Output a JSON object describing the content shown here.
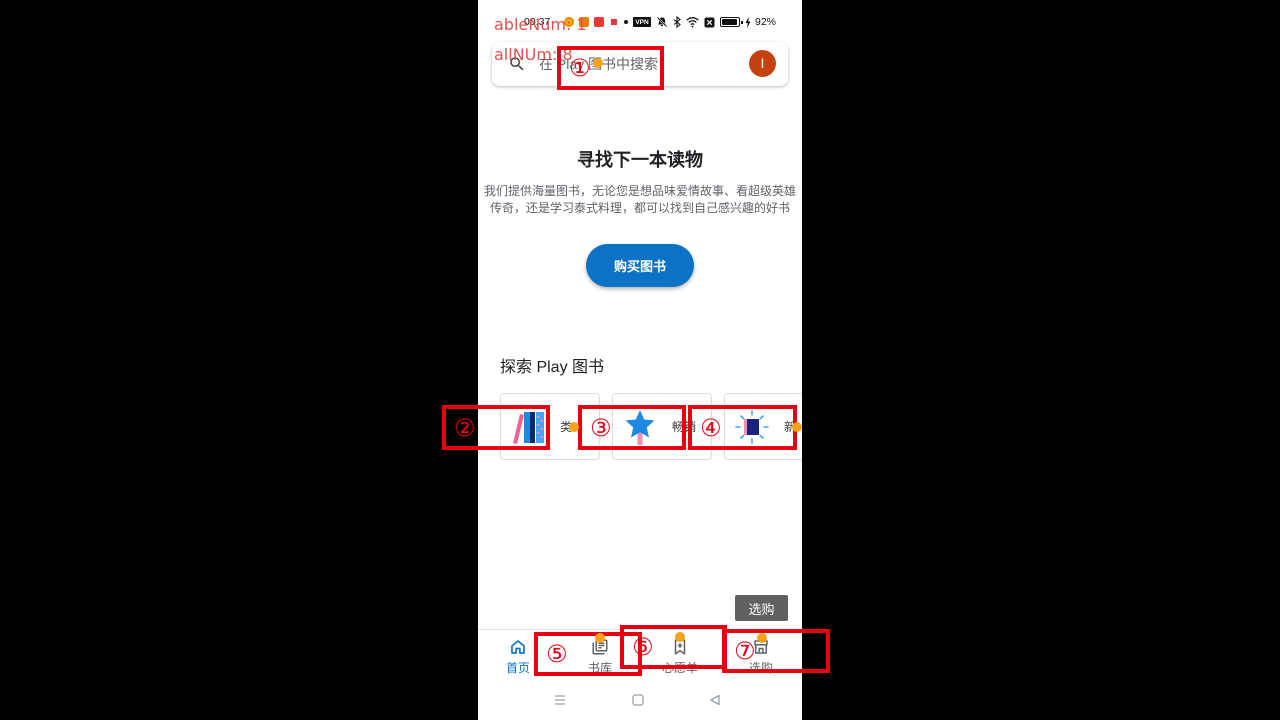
{
  "overlay": {
    "able_num": "ableNum: 1",
    "all_num": "allNUm: 8",
    "marks": [
      "①",
      "②",
      "③",
      "④",
      "⑤",
      "⑥",
      "⑦"
    ]
  },
  "status_bar": {
    "time": "00:37",
    "vpn_badge": "VPN",
    "battery": "92%",
    "icons": [
      "app-icon",
      "app-icon",
      "app-icon",
      "app-icon",
      "dot-icon",
      "vpn-badge",
      "mute-icon",
      "bluetooth-icon",
      "wifi-icon",
      "alarm-box-icon",
      "battery-icon",
      "charging-icon"
    ]
  },
  "search": {
    "icon": "search-icon",
    "placeholder": "在 Play 图书中搜索",
    "avatar_initial": "I"
  },
  "hero": {
    "title": "寻找下一本读物",
    "description": "我们提供海量图书，无论您是想品味爱情故事、看超级英雄传奇，还是学习泰式料理，都可以找到自己感兴趣的好书",
    "button_label": "购买图书"
  },
  "explore": {
    "title": "探索 Play 图书",
    "cards": [
      {
        "label": "类",
        "icon": "books-icon"
      },
      {
        "label": "畅销",
        "icon": "star-icon"
      },
      {
        "label": "新",
        "icon": "sparkle-book-icon"
      }
    ]
  },
  "tooltip": {
    "label": "选购"
  },
  "bottom_nav": {
    "items": [
      {
        "label": "首页",
        "icon": "home-icon",
        "selected": true
      },
      {
        "label": "书库",
        "icon": "library-icon",
        "selected": false
      },
      {
        "label": "心愿单",
        "icon": "wishlist-icon",
        "selected": false
      },
      {
        "label": "选购",
        "icon": "shop-icon",
        "selected": false
      }
    ]
  },
  "system_nav": {
    "icons": [
      "recents-icon",
      "home-square-icon",
      "back-icon"
    ]
  },
  "colors": {
    "accent": "#0b72c6",
    "avatar": "#c4420f",
    "mark_box": "#e60012",
    "mark_dot": "#f5a319",
    "overlay_text": "#e0504f",
    "tooltip_bg": "#616161"
  }
}
